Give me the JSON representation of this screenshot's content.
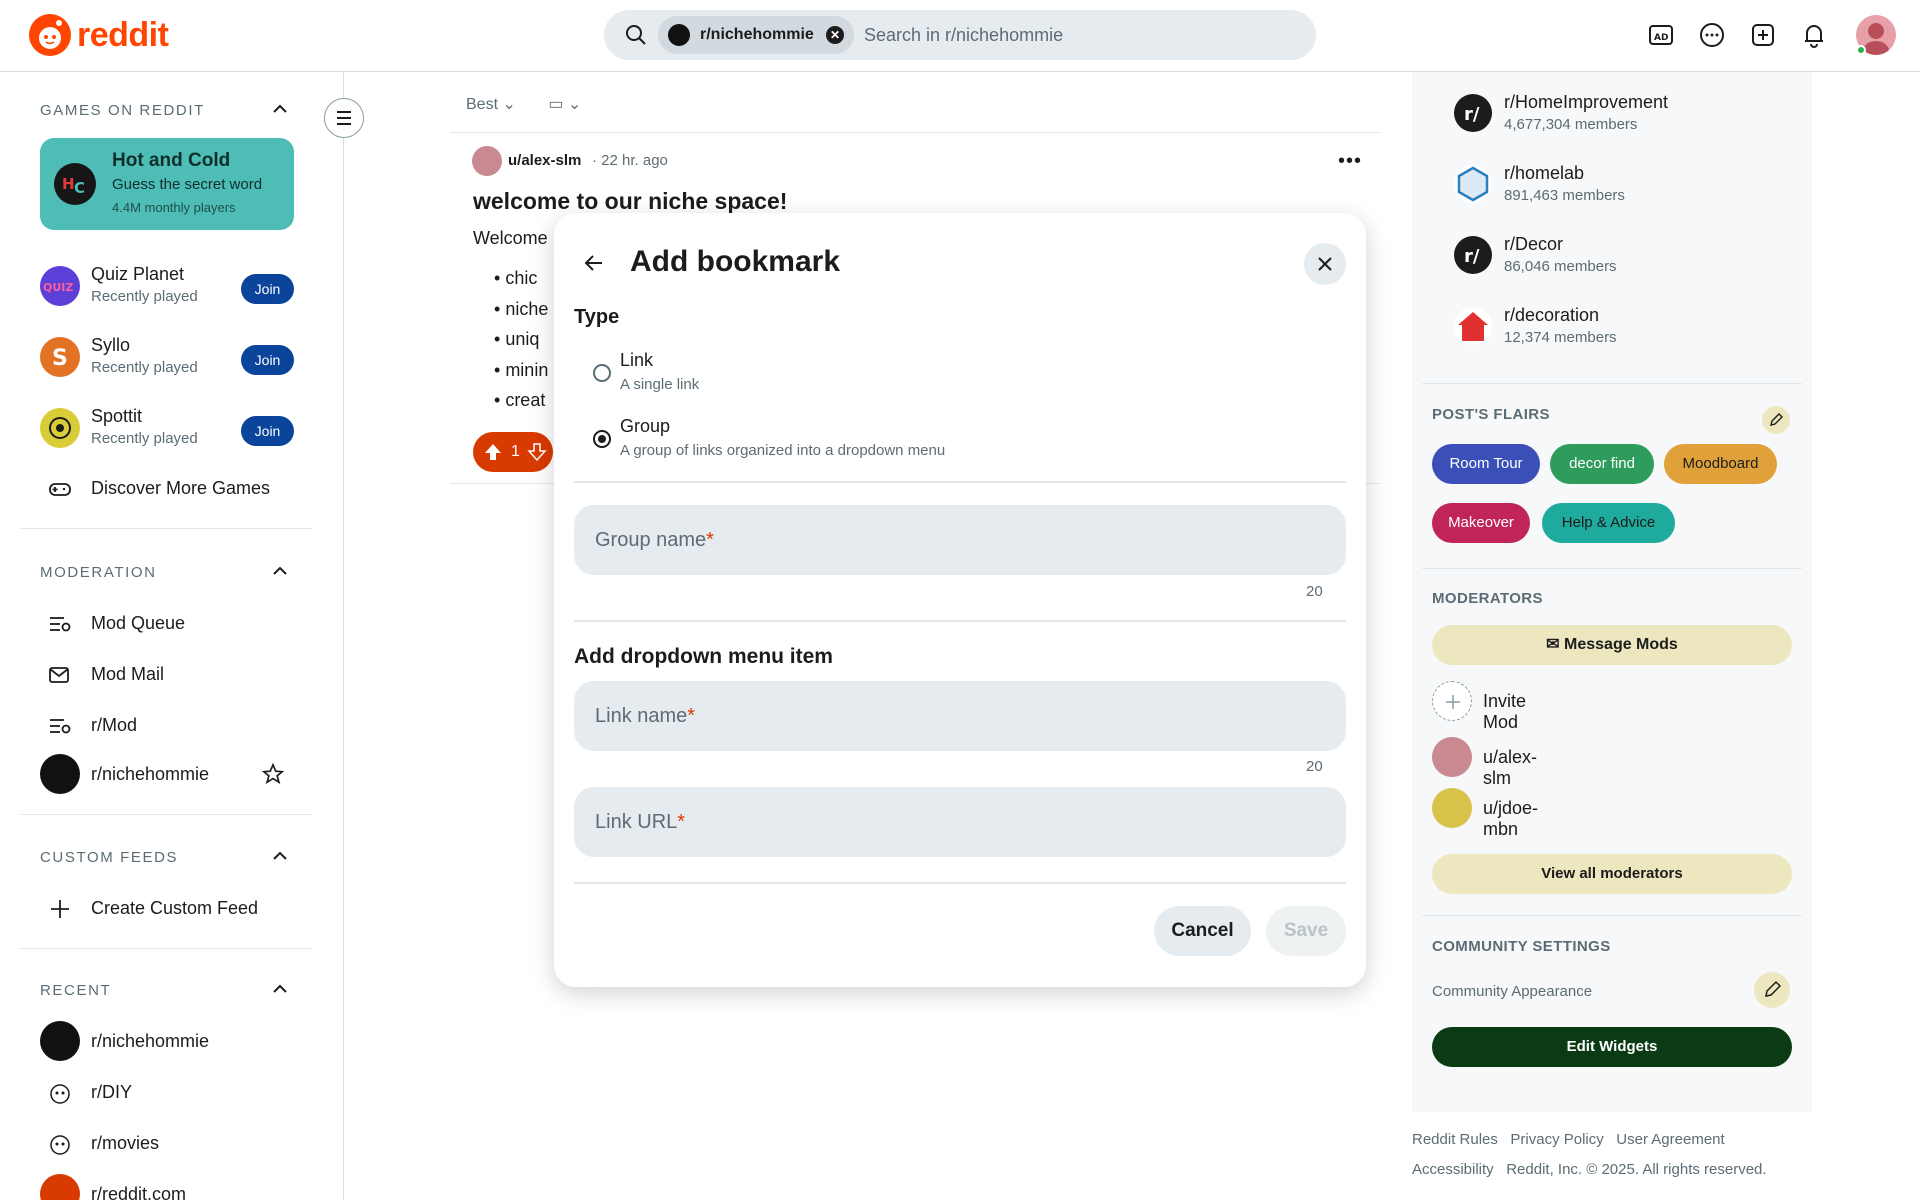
{
  "header": {
    "logo_text": "reddit",
    "search_chip": "r/nichehommie",
    "search_placeholder": "Search in r/nichehommie",
    "icons": [
      "ad-icon",
      "chat-icon",
      "create-post-icon",
      "notification-bell-icon",
      "user-avatar"
    ]
  },
  "left_sidebar": {
    "games_title": "GAMES ON REDDIT",
    "featured_game": {
      "title": "Hot and Cold",
      "subtitle": "Guess the secret word",
      "meta": "4.4M monthly players"
    },
    "games": [
      {
        "name": "Quiz Planet",
        "status": "Recently played",
        "action": "Join",
        "color": "#5b3fd6"
      },
      {
        "name": "Syllo",
        "status": "Recently played",
        "action": "Join",
        "color": "#e37324"
      },
      {
        "name": "Spottit",
        "status": "Recently played",
        "action": "Join",
        "color": "#d8cd37"
      }
    ],
    "discover_label": "Discover More Games",
    "moderation_title": "MODERATION",
    "moderation_items": [
      "Mod Queue",
      "Mod Mail",
      "r/Mod",
      "r/nichehommie"
    ],
    "custom_feeds_title": "CUSTOM FEEDS",
    "create_feed_label": "Create Custom Feed",
    "recent_title": "RECENT",
    "recent_items": [
      "r/nichehommie",
      "r/DIY",
      "r/movies",
      "r/reddit.com"
    ]
  },
  "feed": {
    "sort_label": "Best",
    "post": {
      "author": "u/alex-slm",
      "time": "22 hr. ago",
      "title": "welcome to our niche space!",
      "body_start": "Welcome",
      "bullets": [
        "chic",
        "niche",
        "uniq",
        "minin",
        "creat"
      ],
      "votes": "1"
    }
  },
  "modal": {
    "title": "Add bookmark",
    "type_label": "Type",
    "options": [
      {
        "label": "Link",
        "description": "A single link",
        "selected": false
      },
      {
        "label": "Group",
        "description": "A group of links organized into a dropdown menu",
        "selected": true
      }
    ],
    "group_name_placeholder": "Group name",
    "group_name_counter": "20",
    "dropdown_heading": "Add dropdown menu item",
    "link_name_placeholder": "Link name",
    "link_name_counter": "20",
    "link_url_placeholder": "Link URL",
    "required_mark": "*",
    "cancel_label": "Cancel",
    "save_label": "Save"
  },
  "right_sidebar": {
    "communities": [
      {
        "name": "r/HomeImprovement",
        "members": "4,677,304 members",
        "color": "#1c1c1c"
      },
      {
        "name": "r/homelab",
        "members": "891,463 members",
        "color": "#2a7fbf"
      },
      {
        "name": "r/Decor",
        "members": "86,046 members",
        "color": "#1c1c1c"
      },
      {
        "name": "r/decoration",
        "members": "12,374 members",
        "color": "#e03030"
      }
    ],
    "flairs_title": "POST'S FLAIRS",
    "flairs": [
      {
        "label": "Room Tour",
        "bg": "#3a4fb8",
        "fg": "#ffffff"
      },
      {
        "label": "decor find",
        "bg": "#2e9c5c",
        "fg": "#ffffff"
      },
      {
        "label": "Moodboard",
        "bg": "#e0a13a",
        "fg": "#1c1c1c"
      },
      {
        "label": "Makeover",
        "bg": "#c0245b",
        "fg": "#ffffff"
      },
      {
        "label": "Help & Advice",
        "bg": "#1eaa9c",
        "fg": "#1c1c1c"
      }
    ],
    "moderators_title": "MODERATORS",
    "message_mods": "Message Mods",
    "invite_mod": "Invite Mod",
    "moderators": [
      "u/alex-slm",
      "u/jdoe-mbn"
    ],
    "view_all": "View all moderators",
    "community_settings_title": "COMMUNITY SETTINGS",
    "community_appearance": "Community Appearance",
    "edit_widgets": "Edit Widgets"
  },
  "footer": {
    "links_row1": [
      "Reddit Rules",
      "Privacy Policy",
      "User Agreement"
    ],
    "accessibility": "Accessibility",
    "copyright": "Reddit, Inc. © 2025. All rights reserved."
  }
}
